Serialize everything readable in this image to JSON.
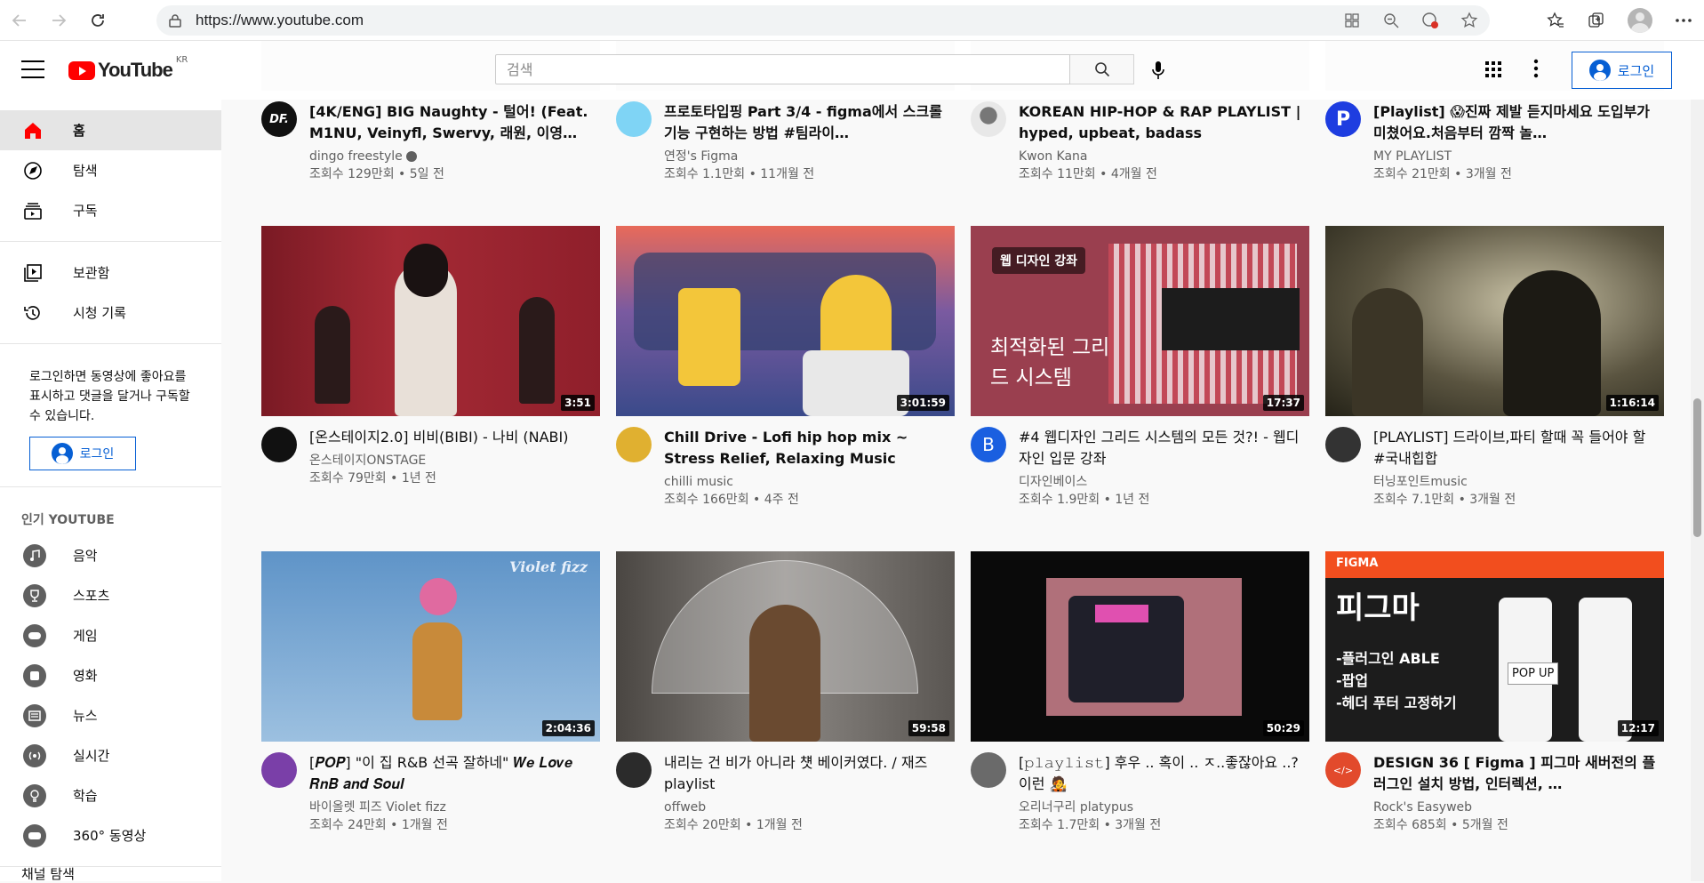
{
  "browser": {
    "url": "https://www.youtube.com"
  },
  "header": {
    "logo_text": "YouTube",
    "logo_region": "KR",
    "search_placeholder": "검색",
    "login_label": "로그인"
  },
  "sidebar": {
    "main": [
      {
        "label": "홈",
        "icon": "home-icon",
        "active": true
      },
      {
        "label": "탐색",
        "icon": "explore-icon"
      },
      {
        "label": "구독",
        "icon": "subscriptions-icon"
      }
    ],
    "library": [
      {
        "label": "보관함",
        "icon": "library-icon"
      },
      {
        "label": "시청 기록",
        "icon": "history-icon"
      }
    ],
    "login_prompt": "로그인하면 동영상에 좋아요를 표시하고 댓글을 달거나 구독할 수 있습니다.",
    "login_label": "로그인",
    "popular_title": "인기 YOUTUBE",
    "popular": [
      {
        "label": "음악",
        "icon": "music-icon"
      },
      {
        "label": "스포츠",
        "icon": "sports-icon"
      },
      {
        "label": "게임",
        "icon": "gaming-icon"
      },
      {
        "label": "영화",
        "icon": "movies-icon"
      },
      {
        "label": "뉴스",
        "icon": "news-icon"
      },
      {
        "label": "실시간",
        "icon": "live-icon"
      },
      {
        "label": "학습",
        "icon": "learning-icon"
      },
      {
        "label": "360° 동영상",
        "icon": "360-video-icon"
      }
    ],
    "bottom_label": "채널 탐색"
  },
  "videos": [
    {
      "title": "[4K/ENG] BIG Naughty - 털어! (Feat. M1NU, Veinyfl, Swervy, 래원, 이영…",
      "channel": "dingo freestyle",
      "verified": true,
      "stats": "조회수 129만회 • 5일 전",
      "duration": "",
      "avatar_color": "#111111",
      "avatar_text": "DF.",
      "thumb": "#3a3a48"
    },
    {
      "title": "프로토타입핑 Part 3/4 - figma에서 스크롤 기능 구현하는 방법 #팀라이…",
      "channel": "연정's Figma",
      "stats": "조회수 1.1만회 • 11개월 전",
      "duration": "",
      "avatar_color": "#7fd4f5",
      "avatar_text": "",
      "thumb": "#5a5a70"
    },
    {
      "title": "KOREAN HIP-HOP & RAP PLAYLIST | hyped, upbeat, badass",
      "channel": "Kwon Kana",
      "stats": "조회수 11만회 • 4개월 전",
      "duration": "",
      "avatar_color": "#2a2a2a",
      "avatar_text": "",
      "thumb": "#40404e"
    },
    {
      "title": "[Playlist] 😱진짜 제발 듣지마세요 도입부가 미쳤어요.처음부터 깜짝 놀…",
      "channel": "MY PLAYLIST",
      "stats": "조회수 21만회 • 3개월 전",
      "duration": "",
      "avatar_color": "#1e3de0",
      "avatar_text": "P",
      "thumb": "#2c2c3a"
    },
    {
      "title": "[온스테이지2.0] 비비(BIBI) - 나비 (NABI)",
      "channel": "온스테이지ONSTAGE",
      "stats": "조회수 79만회 • 1년 전",
      "duration": "3:51",
      "avatar_color": "#111111",
      "avatar_text": "",
      "thumb": "#8f1f2b"
    },
    {
      "title": "Chill Drive - Lofi hip hop mix ~ Stress Relief, Relaxing Music",
      "channel": "chilli music",
      "stats": "조회수 166만회 • 4주 전",
      "duration": "3:01:59",
      "avatar_color": "#e0b030",
      "avatar_text": "",
      "thumb": "#5a6fb0"
    },
    {
      "title": "#4 웹디자인 그리드 시스템의 모든 것?! - 웹디자인 입문 강좌",
      "channel": "디자인베이스",
      "stats": "조회수 1.9만회 • 1년 전",
      "duration": "17:37",
      "avatar_color": "#1a5fe0",
      "avatar_text": "B",
      "thumb": "#9a3f4f",
      "overlay_tag": "웹 디자인 강좌",
      "overlay_text": "최적화된 그리드 시스템"
    },
    {
      "title": "[PLAYLIST] 드라이브,파티 할때 꼭 들어야 할 #국내힙합",
      "channel": "터닝포인트music",
      "stats": "조회수 7.1만회 • 3개월 전",
      "duration": "1:16:14",
      "avatar_color": "#333333",
      "avatar_text": "",
      "thumb": "#4a4636"
    },
    {
      "title": "[𝑷𝑶𝑷] \"이 집 R&B 선곡 잘하네\" 𝑾𝒆 𝑳𝒐𝒗𝒆 𝑹𝒏𝑩 𝒂𝒏𝒅 𝑺𝒐𝒖𝒍",
      "channel": "바이올렛 피즈 Violet fizz",
      "stats": "조회수 24만회 • 1개월 전",
      "duration": "2:04:36",
      "avatar_color": "#7a3fa8",
      "avatar_text": "",
      "thumb": "#6fa0d0",
      "overlay_tag": "Violet fizz"
    },
    {
      "title": "내리는 건 비가 아니라 첏 베이커였다. / 재즈 playlist",
      "channel": "offweb",
      "stats": "조회수 20만회 • 1개월 전",
      "duration": "59:58",
      "avatar_color": "#2b2b2b",
      "avatar_text": "",
      "thumb": "#6e6a66"
    },
    {
      "title": "[𝚙𝚕𝚊𝚢𝚕𝚒𝚜𝚝] 후우 .. 혹이 .. ㅈ..좋잖아요 ..? 이런 🧑‍🎤",
      "channel": "오리너구리 platypus",
      "stats": "조회수 1.7만회 • 3개월 전",
      "duration": "50:29",
      "avatar_color": "#6a6a6a",
      "avatar_text": "",
      "thumb": "#0a0a0a"
    },
    {
      "title": "DESIGN 36 [ Figma ] 피그마 새버전의 플러그인 설치 방법, 인터렉션, …",
      "channel": "Rock's Easyweb",
      "stats": "조회수 685회 • 5개월 전",
      "duration": "12:17",
      "avatar_color": "#e24a2c",
      "avatar_text": "</>",
      "thumb": "#1c1c1c",
      "overlay_tag": "FIGMA",
      "overlay_text": "피그마"
    }
  ],
  "figma_thumb_lines": [
    "-플러그인 ABLE",
    "-팝업",
    "-헤더 푸터 고정하기"
  ],
  "figma_thumb_popup": "POP UP",
  "colors": {
    "brand": "#ff0000",
    "link_blue": "#065fd4",
    "secondary_text": "#606060"
  }
}
